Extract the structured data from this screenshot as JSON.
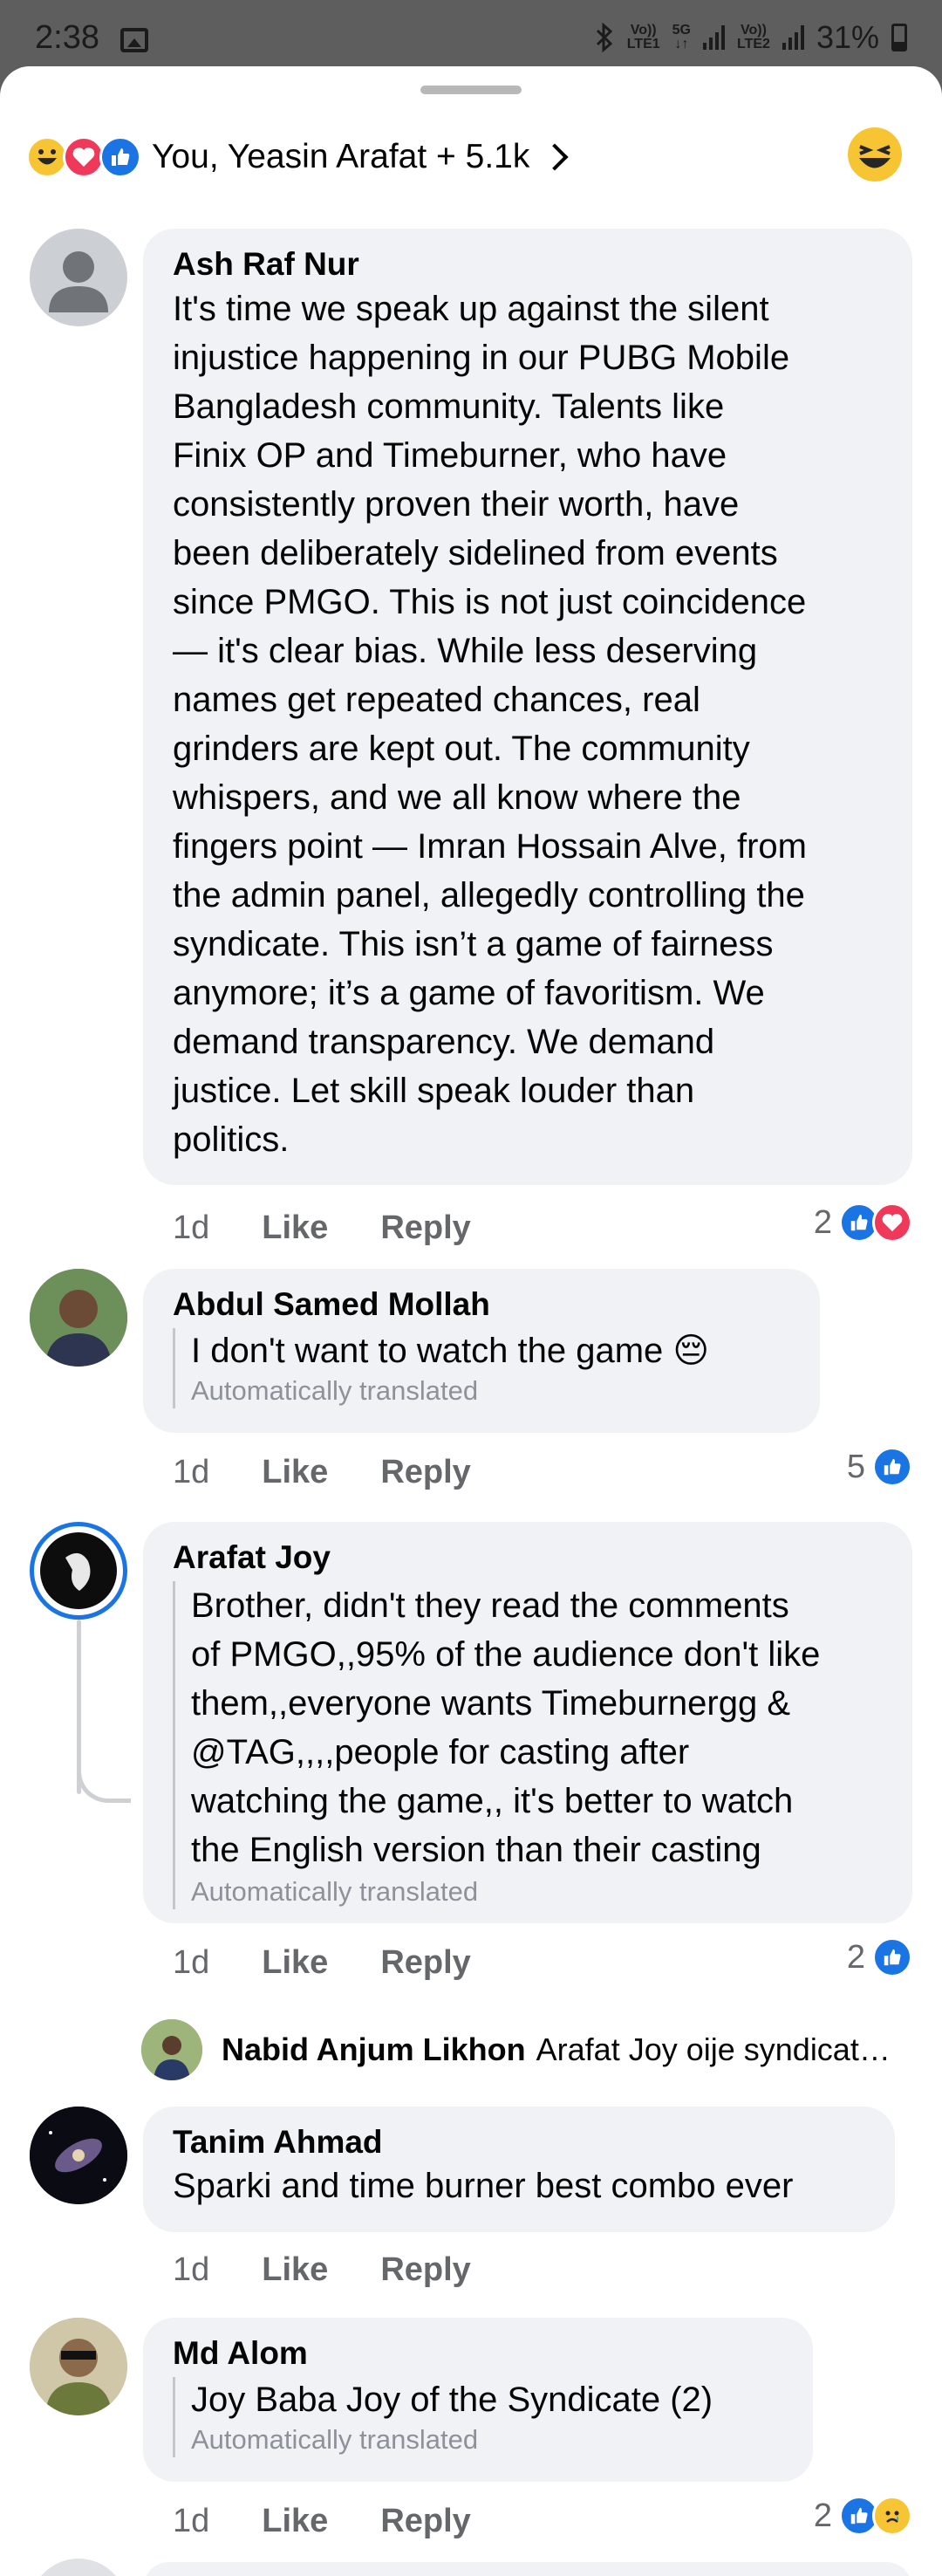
{
  "status_bar": {
    "time": "2:38",
    "net1_top": "Vo))",
    "net1_bottom": "LTE1",
    "net_5g": "5G",
    "net2_top": "Vo))",
    "net2_bottom": "LTE2",
    "battery": "31%"
  },
  "reactions": {
    "names": "You, Yeasin Arafat + 5.1k"
  },
  "comments": [
    {
      "name": "Ash Raf Nur",
      "text_lines": [
        "It's time we speak up against the silent",
        "injustice happening in our PUBG Mobile",
        "Bangladesh community. Talents like",
        "Finix OP and Timeburner, who have",
        "consistently proven their worth, have",
        "been deliberately sidelined from events",
        "since PMGO. This is not just coincidence",
        "— it's clear bias. While less deserving",
        "names get repeated chances, real",
        "grinders are kept out. The community",
        "whispers, and we all know where the",
        "fingers point — Imran Hossain Alve, from",
        "the admin panel, allegedly controlling the",
        "syndicate. This isn’t a game of fairness",
        "anymore; it’s a game of favoritism. We",
        "demand transparency. We demand",
        "justice. Let skill speak louder than",
        "politics."
      ],
      "time": "1d",
      "like": "Like",
      "reply": "Reply",
      "reaction_count": "2"
    },
    {
      "name": "Abdul Samed Mollah",
      "text": "I don't want to watch the game 😔",
      "translated": "Automatically translated",
      "time": "1d",
      "like": "Like",
      "reply": "Reply",
      "reaction_count": "5"
    },
    {
      "name": "Arafat Joy",
      "text_lines": [
        "Brother, didn't they read the comments",
        "of PMGO,,95% of the audience don't like",
        "them,,everyone wants Timeburnergg &",
        "@TAG,,,,people for casting after",
        "watching the game,, it's better to watch",
        "the English version than their casting"
      ],
      "translated": "Automatically translated",
      "time": "1d",
      "like": "Like",
      "reply": "Reply",
      "reaction_count": "2",
      "reply_preview": {
        "name": "Nabid Anjum Likhon",
        "snippet": "Arafat Joy oije syndicat…"
      }
    },
    {
      "name": "Tanim Ahmad",
      "text": "Sparki and time burner best combo ever",
      "time": "1d",
      "like": "Like",
      "reply": "Reply"
    },
    {
      "name": "Md Alom",
      "text": "Joy Baba Joy of the Syndicate (2)",
      "translated": "Automatically translated",
      "time": "1d",
      "like": "Like",
      "reply": "Reply",
      "reaction_count": "2"
    }
  ],
  "colors": {
    "accent_like": "#1b74e4",
    "love": "#f0385a",
    "haha": "#f7c533",
    "bubble": "#f0f2f5",
    "meta": "#65676b"
  }
}
